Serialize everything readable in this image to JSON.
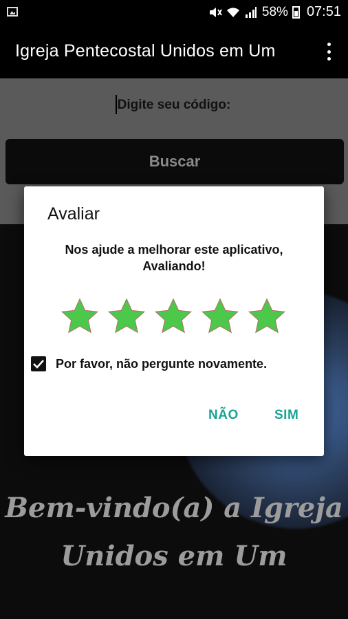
{
  "status_bar": {
    "battery_percent": "58%",
    "time": "07:51",
    "icons": [
      "image-icon",
      "mute-icon",
      "wifi-icon",
      "signal-icon",
      "battery-icon"
    ]
  },
  "app_bar": {
    "title": "Igreja Pentecostal Unidos em Um",
    "menu_icon": "more-vert-icon"
  },
  "search": {
    "placeholder": "Digite seu código:",
    "button_label": "Buscar"
  },
  "welcome_text": {
    "line1": "Bem-vindo(a) a Igreja",
    "line2": "Unidos em Um"
  },
  "dialog": {
    "title": "Avaliar",
    "message_line1": "Nos ajude a melhorar este aplicativo,",
    "message_line2": "Avaliando!",
    "rating": 5,
    "rating_max": 5,
    "checkbox_label": "Por favor, não pergunte novamente.",
    "checkbox_checked": true,
    "negative_label": "NÃO",
    "positive_label": "SIM"
  },
  "colors": {
    "accent": "#1aa394",
    "star": "#4cc84a",
    "app_bar": "#000000"
  }
}
